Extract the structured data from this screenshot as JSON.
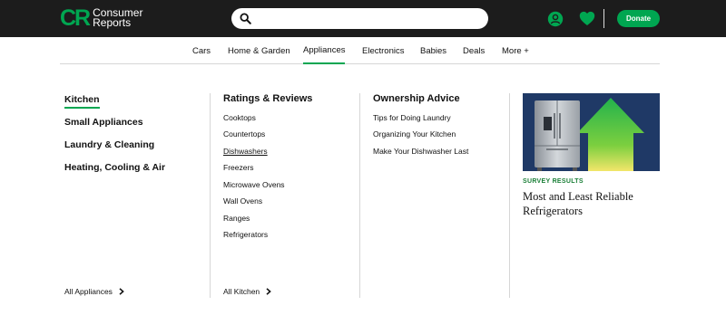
{
  "brand": {
    "logo_mark": "CR",
    "logo_line1": "Consumer",
    "logo_line2": "Reports",
    "accent_color": "#00a651"
  },
  "header": {
    "search_placeholder": "",
    "search_value": "",
    "donate_label": "Donate",
    "icons": [
      "search-icon",
      "account-icon",
      "heart-icon"
    ]
  },
  "nav": {
    "items": [
      "Cars",
      "Home & Garden",
      "Appliances",
      "Electronics",
      "Babies",
      "Deals",
      "More +"
    ],
    "active": "Appliances"
  },
  "sidebar": {
    "categories": [
      "Kitchen",
      "Small Appliances",
      "Laundry & Cleaning",
      "Heating, Cooling & Air"
    ],
    "active": "Kitchen",
    "all_link": "All Appliances"
  },
  "ratings": {
    "title": "Ratings & Reviews",
    "links": [
      "Cooktops",
      "Countertops",
      "Dishwashers",
      "Freezers",
      "Microwave Ovens",
      "Wall Ovens",
      "Ranges",
      "Refrigerators"
    ],
    "hovered": "Dishwashers",
    "all_link": "All Kitchen"
  },
  "advice": {
    "title": "Ownership Advice",
    "links": [
      "Tips for Doing Laundry",
      "Organizing Your Kitchen",
      "Make Your Dishwasher Last"
    ]
  },
  "promo": {
    "eyebrow": "SURVEY RESULTS",
    "title": "Most and Least Reliable Refrigerators",
    "image_icon": "refrigerator-with-up-arrow-image"
  }
}
